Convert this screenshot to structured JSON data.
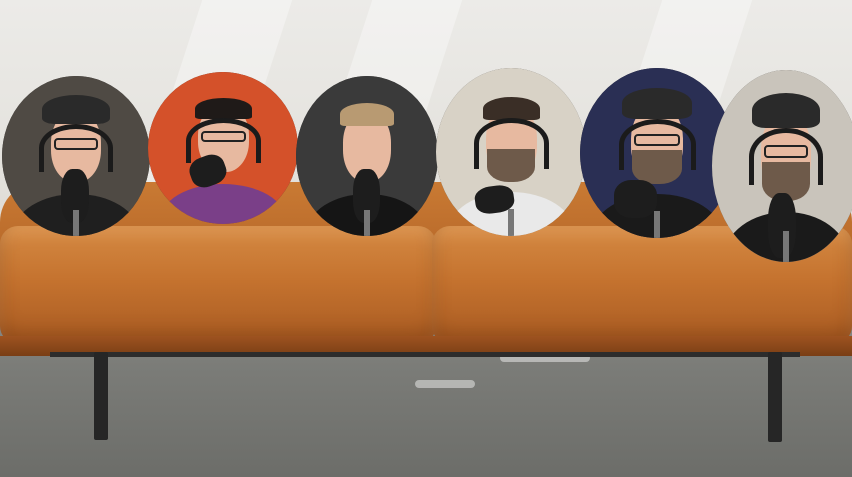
{
  "scene": {
    "description_tag": "video-call-participants-on-virtual-sofa",
    "background": "orange-leather-sofa",
    "colors": {
      "sofa": "#c5732f",
      "wall": "#e8e6e2",
      "floor": "#7b7c78"
    }
  },
  "participants": [
    {
      "id": "participant-1",
      "cap": true,
      "glasses": true,
      "headphones": true,
      "beard": false,
      "bg": "#4f4a44",
      "shirt": "#1f1f1f"
    },
    {
      "id": "participant-2",
      "cap": false,
      "glasses": true,
      "headphones": true,
      "beard": false,
      "bg": "#d4512a",
      "shirt": "#7a3f88"
    },
    {
      "id": "participant-3",
      "cap": false,
      "glasses": false,
      "headphones": false,
      "beard": false,
      "bg": "#3a3a3a",
      "shirt": "#151515"
    },
    {
      "id": "participant-4",
      "cap": false,
      "glasses": false,
      "headphones": true,
      "beard": true,
      "bg": "#d8d2c6",
      "shirt": "#e9e9e9"
    },
    {
      "id": "participant-5",
      "cap": true,
      "glasses": true,
      "headphones": true,
      "beard": true,
      "bg": "#2a2f54",
      "shirt": "#1a1a1a"
    },
    {
      "id": "participant-6",
      "cap": true,
      "glasses": true,
      "headphones": true,
      "beard": true,
      "bg": "#c9c4bb",
      "shirt": "#1a1a1a"
    }
  ]
}
